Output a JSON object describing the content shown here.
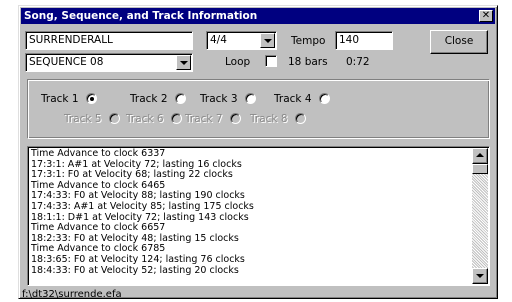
{
  "window": {
    "title": "Song, Sequence, and Track Information",
    "close_glyph": "✕"
  },
  "song": {
    "value": "SURRENDERALL"
  },
  "time_signature": {
    "value": "4/4"
  },
  "tempo": {
    "label": "Tempo",
    "value": "140"
  },
  "close_button": {
    "label": "Close"
  },
  "sequence": {
    "value": "SEQUENCE 08"
  },
  "loop": {
    "label": "Loop",
    "checked": false
  },
  "bars": {
    "label": "18 bars",
    "time": "0:72"
  },
  "tracks": [
    {
      "label": "Track 1",
      "selected": true,
      "enabled": true
    },
    {
      "label": "Track 2",
      "selected": false,
      "enabled": true
    },
    {
      "label": "Track 3",
      "selected": false,
      "enabled": true
    },
    {
      "label": "Track 4",
      "selected": false,
      "enabled": true
    },
    {
      "label": "Track 5",
      "selected": false,
      "enabled": false
    },
    {
      "label": "Track 6",
      "selected": false,
      "enabled": false
    },
    {
      "label": "Track 7",
      "selected": false,
      "enabled": false
    },
    {
      "label": "Track 8",
      "selected": false,
      "enabled": false
    }
  ],
  "log": [
    "Time Advance to clock 6337",
    "17:3:1: A#1 at Velocity 72; lasting 16 clocks",
    "17:3:1: F0 at Velocity 68; lasting 22 clocks",
    "Time Advance to clock 6465",
    "17:4:33: F0 at Velocity 88; lasting 190 clocks",
    "17:4:33: A#1 at Velocity 85; lasting 175 clocks",
    "18:1:1: D#1 at Velocity 72; lasting 143 clocks",
    "Time Advance to clock 6657",
    "18:2:33: F0 at Velocity 48; lasting 15 clocks",
    "Time Advance to clock 6785",
    "18:3:65: F0 at Velocity 124; lasting 76 clocks",
    "18:4:33: F0 at Velocity 52; lasting 20 clocks"
  ],
  "status": {
    "path": "f:\\dt32\\surrende.efa"
  },
  "icons": {
    "title_close": "close-icon",
    "dropdown": "chevron-down-icon",
    "scroll_up": "arrow-up-icon",
    "scroll_down": "arrow-down-icon"
  },
  "colors": {
    "titlebar": "#000080",
    "face": "#c0c0c0",
    "disabled_text": "#8a8a8a"
  }
}
